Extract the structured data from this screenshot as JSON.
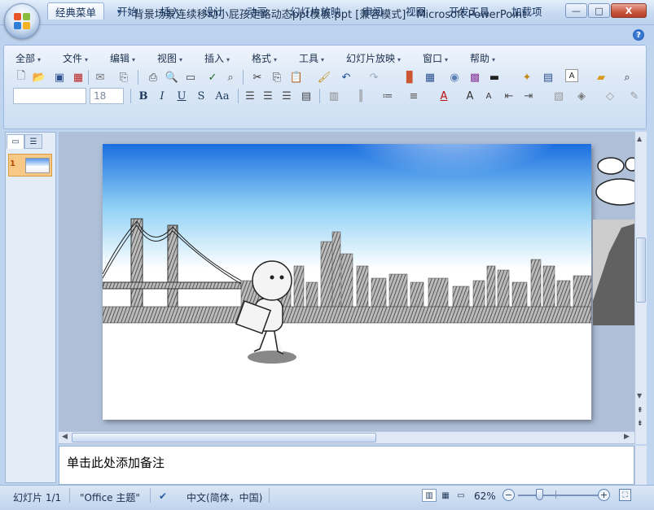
{
  "titlebar": {
    "title": "背景场景连续移动小屁孩走路动态ppt模板.ppt [兼容模式] - Microsoft PowerPoint",
    "minimize_label": "—",
    "maximize_label": "□",
    "close_label": "X"
  },
  "tabs": [
    "经典菜单",
    "开始",
    "插入",
    "设计",
    "动画",
    "幻灯片放映",
    "审阅",
    "视图",
    "开发工具",
    "加载项"
  ],
  "classic_menu": [
    "全部",
    "文件",
    "编辑",
    "视图",
    "插入",
    "格式",
    "工具",
    "幻灯片放映",
    "窗口",
    "帮助"
  ],
  "font": {
    "name_value": "",
    "size_value": "18"
  },
  "format_buttons": [
    "B",
    "I",
    "U",
    "S",
    "Aa"
  ],
  "slide_panel": {
    "slide_number": "1"
  },
  "notes": {
    "placeholder": "单击此处添加备注"
  },
  "statusbar": {
    "slide_info": "幻灯片 1/1",
    "theme": "\"Office 主题\"",
    "language": "中文(简体，中国)",
    "zoom": "62%"
  },
  "colors": {
    "accent": "#bcd2ee",
    "ribbon": "#dde9f7"
  }
}
